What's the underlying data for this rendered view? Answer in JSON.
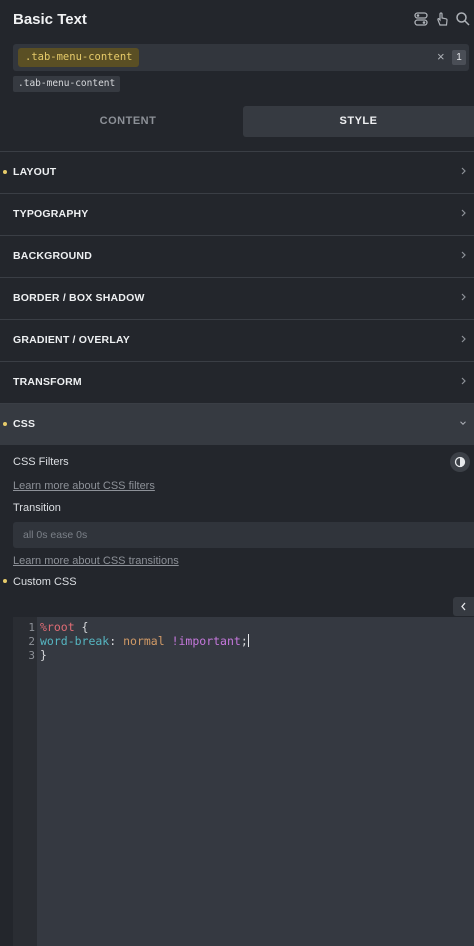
{
  "header": {
    "title": "Basic Text",
    "icons": [
      "toggle-icon",
      "pointer-hand-icon",
      "search-icon"
    ]
  },
  "selector": {
    "active_class": ".tab-menu-content",
    "count": "1",
    "close_glyph": "×",
    "tag": ".tab-menu-content"
  },
  "tabs": [
    {
      "label": "CONTENT",
      "active": false
    },
    {
      "label": "STYLE",
      "active": true
    }
  ],
  "sections": [
    {
      "label": "LAYOUT",
      "modified": true
    },
    {
      "label": "TYPOGRAPHY",
      "modified": false
    },
    {
      "label": "BACKGROUND",
      "modified": false
    },
    {
      "label": "BORDER / BOX SHADOW",
      "modified": false
    },
    {
      "label": "GRADIENT / OVERLAY",
      "modified": false
    },
    {
      "label": "TRANSFORM",
      "modified": false
    },
    {
      "label": "CSS",
      "modified": true,
      "open": true
    }
  ],
  "css_panel": {
    "filters_label": "CSS Filters",
    "filters_link": "Learn more about CSS filters",
    "transition_label": "Transition",
    "transition_placeholder": "all 0s ease 0s",
    "transition_link": "Learn more about CSS transitions",
    "custom_css_label": "Custom CSS"
  },
  "code": {
    "lines": [
      {
        "num": "1",
        "a": "%root",
        "b": " {"
      },
      {
        "num": "2",
        "prop": "word-break",
        "colon": ": ",
        "val": "normal",
        "imp": " !important",
        "semi": ";"
      },
      {
        "num": "3",
        "a": "}"
      }
    ]
  },
  "colors": {
    "background": "#23262c",
    "accent": "#e6cb6a",
    "panel": "#363a41"
  }
}
